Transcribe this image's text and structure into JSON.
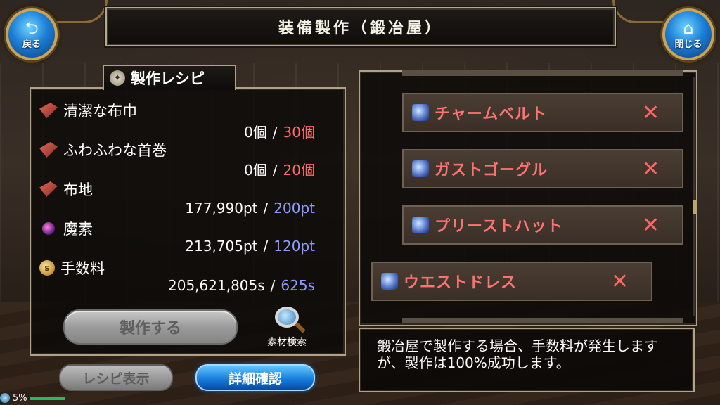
{
  "header": {
    "title": "装備製作（鍛冶屋）",
    "back_label": "戻る",
    "close_label": "閉じる"
  },
  "recipe": {
    "tab_label": "製作レシピ",
    "materials": [
      {
        "name": "清潔な布巾",
        "have": "0個",
        "need": "30個",
        "need_color": "red",
        "icon": "cloth-icon"
      },
      {
        "name": "ふわふわな首巻",
        "have": "0個",
        "need": "20個",
        "need_color": "red",
        "icon": "cloth-icon"
      },
      {
        "name": "布地",
        "have": "177,990pt",
        "need": "200pt",
        "need_color": "blue",
        "icon": "cloth-icon"
      },
      {
        "name": "魔素",
        "have": "213,705pt",
        "need": "120pt",
        "need_color": "blue",
        "icon": "orb-icon"
      },
      {
        "name": "手数料",
        "have": "205,621,805s",
        "need": "625s",
        "need_color": "blue",
        "icon": "coin-icon"
      }
    ],
    "separator": "/",
    "craft_label": "製作する",
    "search_label": "素材検索"
  },
  "tabs": {
    "recipe_label": "レシピ表示",
    "detail_label": "詳細確認"
  },
  "items": [
    {
      "name": "チャームベルト",
      "mark": "✕"
    },
    {
      "name": "ガストゴーグル",
      "mark": "✕"
    },
    {
      "name": "プリーストハット",
      "mark": "✕"
    },
    {
      "name": "ウエストドレス",
      "mark": "✕"
    }
  ],
  "message": "鍛冶屋で製作する場合、手数料が発生しますが、製作は100%成功します。",
  "status": {
    "percent": "5%"
  },
  "colors": {
    "need_red": "#ff6b6b",
    "need_blue": "#8f9cff",
    "item_name": "#ff7272"
  }
}
